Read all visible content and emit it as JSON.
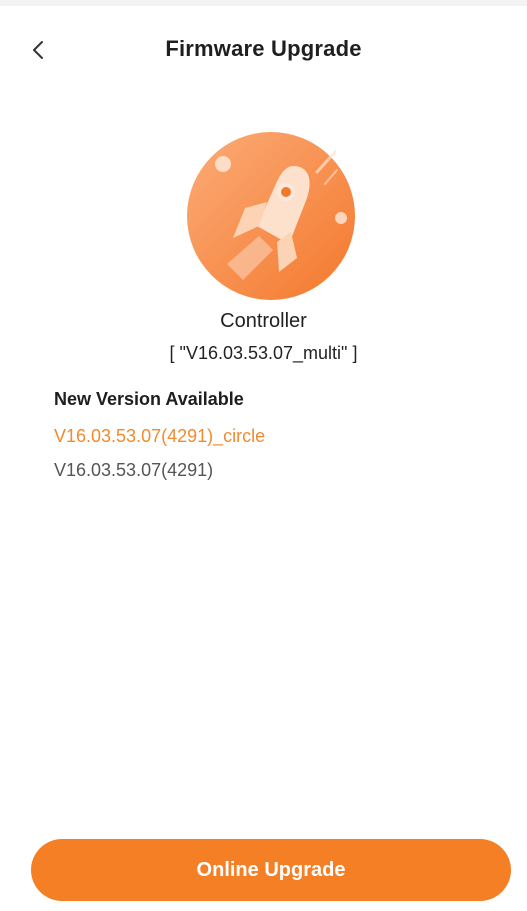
{
  "header": {
    "back_icon": "chevron-left-icon",
    "title": "Firmware Upgrade"
  },
  "hero": {
    "icon": "rocket-icon",
    "colors": {
      "circle_light": "#fba06a",
      "circle_dark": "#f57a30",
      "rocket": "#fde1cc"
    }
  },
  "device": {
    "name": "Controller",
    "version": "[ \"V16.03.53.07_multi\" ]"
  },
  "update": {
    "section_title": "New Version Available",
    "versions": [
      {
        "label": "V16.03.53.07(4291)_circle",
        "color": "#f28a2e"
      },
      {
        "label": "V16.03.53.07(4291)",
        "color": "#555555"
      }
    ]
  },
  "footer": {
    "button_label": "Online Upgrade",
    "button_color": "#f57f24"
  }
}
